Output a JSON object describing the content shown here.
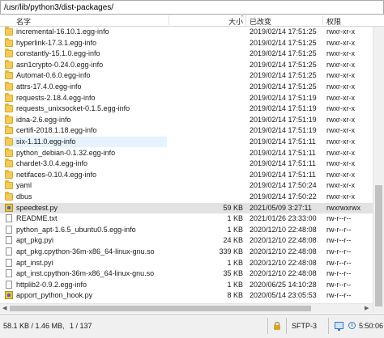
{
  "path": "/usr/lib/python3/dist-packages/",
  "columns": {
    "name": "名字",
    "size": "大小",
    "modified": "已改变",
    "perms": "权限"
  },
  "files": [
    {
      "name": "incremental-16.10.1.egg-info",
      "size": "",
      "modified": "2019/02/14 17:51:25",
      "perms": "rwxr-xr-x",
      "type": "folder"
    },
    {
      "name": "hyperlink-17.3.1.egg-info",
      "size": "",
      "modified": "2019/02/14 17:51:25",
      "perms": "rwxr-xr-x",
      "type": "folder"
    },
    {
      "name": "constantly-15.1.0.egg-info",
      "size": "",
      "modified": "2019/02/14 17:51:25",
      "perms": "rwxr-xr-x",
      "type": "folder"
    },
    {
      "name": "asn1crypto-0.24.0.egg-info",
      "size": "",
      "modified": "2019/02/14 17:51:25",
      "perms": "rwxr-xr-x",
      "type": "folder"
    },
    {
      "name": "Automat-0.6.0.egg-info",
      "size": "",
      "modified": "2019/02/14 17:51:25",
      "perms": "rwxr-xr-x",
      "type": "folder"
    },
    {
      "name": "attrs-17.4.0.egg-info",
      "size": "",
      "modified": "2019/02/14 17:51:25",
      "perms": "rwxr-xr-x",
      "type": "folder"
    },
    {
      "name": "requests-2.18.4.egg-info",
      "size": "",
      "modified": "2019/02/14 17:51:19",
      "perms": "rwxr-xr-x",
      "type": "folder"
    },
    {
      "name": "requests_unixsocket-0.1.5.egg-info",
      "size": "",
      "modified": "2019/02/14 17:51:19",
      "perms": "rwxr-xr-x",
      "type": "folder"
    },
    {
      "name": "idna-2.6.egg-info",
      "size": "",
      "modified": "2019/02/14 17:51:19",
      "perms": "rwxr-xr-x",
      "type": "folder"
    },
    {
      "name": "certifi-2018.1.18.egg-info",
      "size": "",
      "modified": "2019/02/14 17:51:19",
      "perms": "rwxr-xr-x",
      "type": "folder"
    },
    {
      "name": "six-1.11.0.egg-info",
      "size": "",
      "modified": "2019/02/14 17:51:11",
      "perms": "rwxr-xr-x",
      "type": "folder",
      "hover": true
    },
    {
      "name": "python_debian-0.1.32.egg-info",
      "size": "",
      "modified": "2019/02/14 17:51:11",
      "perms": "rwxr-xr-x",
      "type": "folder"
    },
    {
      "name": "chardet-3.0.4.egg-info",
      "size": "",
      "modified": "2019/02/14 17:51:11",
      "perms": "rwxr-xr-x",
      "type": "folder"
    },
    {
      "name": "netifaces-0.10.4.egg-info",
      "size": "",
      "modified": "2019/02/14 17:51:11",
      "perms": "rwxr-xr-x",
      "type": "folder"
    },
    {
      "name": "yaml",
      "size": "",
      "modified": "2019/02/14 17:50:24",
      "perms": "rwxr-xr-x",
      "type": "folder"
    },
    {
      "name": "dbus",
      "size": "",
      "modified": "2019/02/14 17:50:22",
      "perms": "rwxr-xr-x",
      "type": "folder"
    },
    {
      "name": "speedtest.py",
      "size": "59 KB",
      "modified": "2021/05/09 3:27:11",
      "perms": "rwxrwxrwx",
      "type": "script",
      "selected": true
    },
    {
      "name": "README.txt",
      "size": "1 KB",
      "modified": "2021/01/26 23:33:00",
      "perms": "rw-r--r--",
      "type": "file"
    },
    {
      "name": "python_apt-1.6.5_ubuntu0.5.egg-info",
      "size": "1 KB",
      "modified": "2020/12/10 22:48:08",
      "perms": "rw-r--r--",
      "type": "file"
    },
    {
      "name": "apt_pkg.pyi",
      "size": "24 KB",
      "modified": "2020/12/10 22:48:08",
      "perms": "rw-r--r--",
      "type": "file"
    },
    {
      "name": "apt_pkg.cpython-36m-x86_64-linux-gnu.so",
      "size": "339 KB",
      "modified": "2020/12/10 22:48:08",
      "perms": "rw-r--r--",
      "type": "file"
    },
    {
      "name": "apt_inst.pyi",
      "size": "1 KB",
      "modified": "2020/12/10 22:48:08",
      "perms": "rw-r--r--",
      "type": "file"
    },
    {
      "name": "apt_inst.cpython-36m-x86_64-linux-gnu.so",
      "size": "35 KB",
      "modified": "2020/12/10 22:48:08",
      "perms": "rw-r--r--",
      "type": "file"
    },
    {
      "name": "httplib2-0.9.2.egg-info",
      "size": "1 KB",
      "modified": "2020/06/25 14:10:28",
      "perms": "rw-r--r--",
      "type": "file"
    },
    {
      "name": "apport_python_hook.py",
      "size": "8 KB",
      "modified": "2020/05/14 23:05:53",
      "perms": "rw-r--r--",
      "type": "script"
    }
  ],
  "status": {
    "selection": "58.1 KB / 1.46 MB,",
    "count": "1 / 137",
    "protocol": "SFTP-3",
    "time": "5:50:06"
  },
  "icons": {
    "folder": "folder-icon",
    "file": "file-icon",
    "script": "python-script-icon"
  },
  "colors": {
    "selected_row": "#e2e2e2",
    "hover_row": "#e5f3ff",
    "folder": "#f3cb5a"
  }
}
